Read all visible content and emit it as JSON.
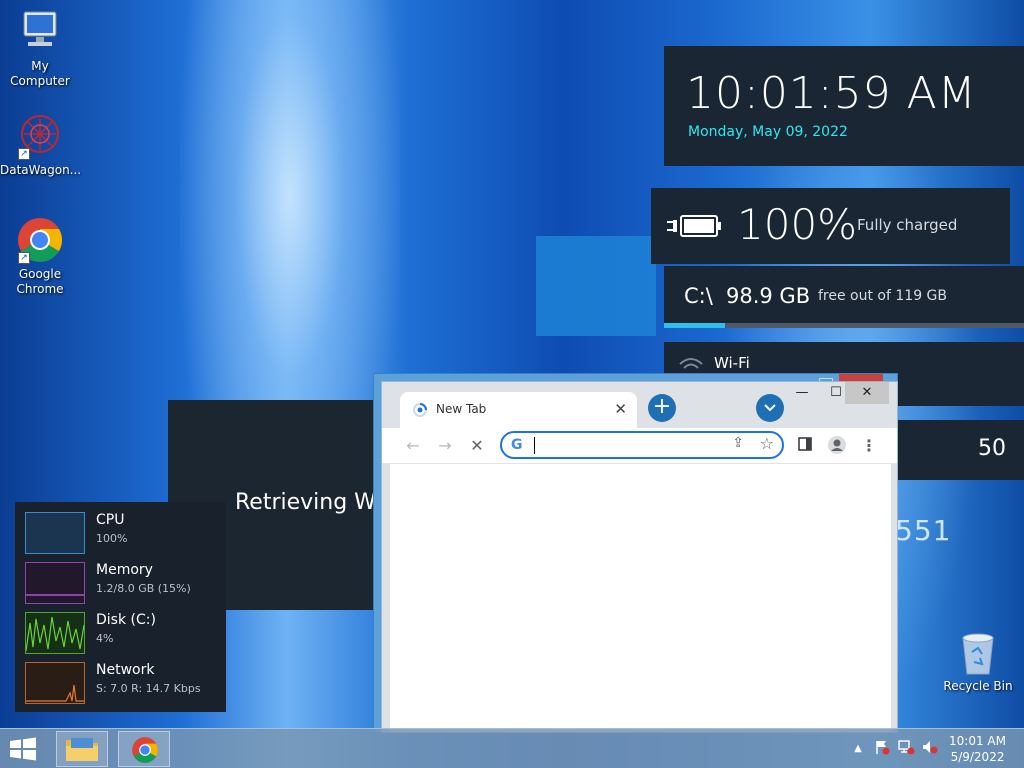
{
  "desktop": {
    "icons": [
      {
        "label": "My Computer"
      },
      {
        "label": "DataWagon..."
      },
      {
        "label": "Google Chrome"
      }
    ],
    "recycle_bin": "Recycle Bin"
  },
  "widgets": {
    "clock": {
      "time": "10:01:59 AM",
      "date": "Monday, May 09, 2022"
    },
    "battery": {
      "percent": "100%",
      "status": "Fully charged"
    },
    "disk": {
      "drive": "C:\\",
      "free": "98.9 GB",
      "total": "free out of 119 GB",
      "used_fraction": 0.17
    },
    "wifi": {
      "label": "Wi-Fi"
    },
    "weather": {
      "value": "50",
      "value2": "551"
    }
  },
  "loading": {
    "message": "Retrieving W"
  },
  "perf": {
    "items": [
      {
        "name": "CPU",
        "value": "100%"
      },
      {
        "name": "Memory",
        "value": "1.2/8.0 GB (15%)"
      },
      {
        "name": "Disk (C:)",
        "value": "4%"
      },
      {
        "name": "Network",
        "value": "S: 7.0 R: 14.7 Kbps"
      }
    ]
  },
  "browser": {
    "tab_title": "New Tab",
    "omnibox_placeholder": "",
    "new_tab_symbol": "+",
    "colors": {
      "accent": "#1a73e8"
    }
  },
  "taskbar": {
    "time": "10:01 AM",
    "date": "5/9/2022"
  }
}
